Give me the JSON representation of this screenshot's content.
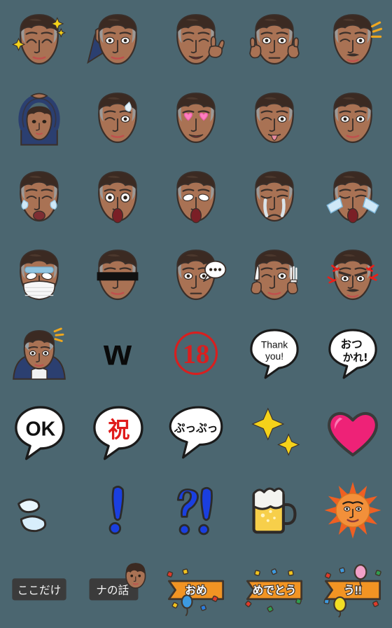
{
  "page": {
    "title": "Emoji sticker set preview",
    "background_color": "#4b6670",
    "columns": 5,
    "rows": 8,
    "cell_size_px": 112,
    "total_stickers": 40
  },
  "palette": {
    "background": "#4b6670",
    "skin": "#a97254",
    "skin_shadow": "#8d5b40",
    "hair": "#3b2a22",
    "hair_gray": "#9aa0a3",
    "outline": "#3a2f2a",
    "suit_navy": "#2b3f70",
    "shirt_white": "#f2f2f2",
    "sparkle_yellow": "#f5d21a",
    "heart_pink": "#ee2277",
    "stamp_red": "#d81f1f",
    "bubble_white": "#ffffff",
    "bubble_outline": "#1a1a1a",
    "banner_orange": "#f29423",
    "banner_outline": "#3f352c",
    "label_dark": "#3b3b3b",
    "beer_amber": "#f7cf4a",
    "beer_foam": "#f4f4f0",
    "sun_orange": "#f2903a",
    "exclaim_blue": "#1a3fe0",
    "tear_blue": "#cfe8f7",
    "angry_red": "#e8201a",
    "red_text": "#e01b1b",
    "blush": "#c0504d"
  },
  "stickers": [
    {
      "row": 1,
      "col": 1,
      "name": "face-sparkle",
      "label": "Face with sparkles",
      "text": ""
    },
    {
      "row": 1,
      "col": 2,
      "name": "face-listening",
      "label": "Hand to ear listening",
      "text": ""
    },
    {
      "row": 1,
      "col": 3,
      "name": "face-peace-sign",
      "label": "Face with peace sign",
      "text": ""
    },
    {
      "row": 1,
      "col": 4,
      "name": "face-thumbs-up-double",
      "label": "Face with two thumbs up",
      "text": ""
    },
    {
      "row": 1,
      "col": 5,
      "name": "face-idea-spark",
      "label": "Face with idea spark",
      "text": ""
    },
    {
      "row": 2,
      "col": 1,
      "name": "face-arms-circle-ok",
      "label": "Arms overhead circle OK",
      "text": ""
    },
    {
      "row": 2,
      "col": 2,
      "name": "face-wink-sweat",
      "label": "Winking face with sweat drop",
      "text": ""
    },
    {
      "row": 2,
      "col": 3,
      "name": "face-heart-eyes",
      "label": "Face with heart eyes",
      "text": ""
    },
    {
      "row": 2,
      "col": 4,
      "name": "face-tongue-out",
      "label": "Face with tongue out",
      "text": ""
    },
    {
      "row": 2,
      "col": 5,
      "name": "face-smirk",
      "label": "Smirking face",
      "text": ""
    },
    {
      "row": 3,
      "col": 1,
      "name": "face-laugh-tears",
      "label": "Laughing with tears of joy",
      "text": ""
    },
    {
      "row": 3,
      "col": 2,
      "name": "face-shocked-wide-eyes",
      "label": "Shocked face wide eyes",
      "text": ""
    },
    {
      "row": 3,
      "col": 3,
      "name": "face-screaming",
      "label": "Screaming face",
      "text": ""
    },
    {
      "row": 3,
      "col": 4,
      "name": "face-crying-streams",
      "label": "Crying face streaming tears",
      "text": ""
    },
    {
      "row": 3,
      "col": 5,
      "name": "face-sobbing-loud",
      "label": "Loudly sobbing face",
      "text": ""
    },
    {
      "row": 4,
      "col": 1,
      "name": "face-sick-mask",
      "label": "Sick face with surgical mask",
      "text": ""
    },
    {
      "row": 4,
      "col": 2,
      "name": "face-censor-bar",
      "label": "Face with censor bar over eyes",
      "text": ""
    },
    {
      "row": 4,
      "col": 3,
      "name": "face-thought-dots",
      "label": "Face with thought bubble dots",
      "text": ""
    },
    {
      "row": 4,
      "col": 4,
      "name": "face-knife-fork",
      "label": "Face holding knife and fork",
      "text": ""
    },
    {
      "row": 4,
      "col": 5,
      "name": "face-angry-veins",
      "label": "Angry face with anger marks",
      "text": ""
    },
    {
      "row": 5,
      "col": 1,
      "name": "figure-bowing-apology",
      "label": "Bowing apology with sweat",
      "text": ""
    },
    {
      "row": 5,
      "col": 2,
      "name": "letter-w-laugh",
      "label": "Black letter w (laughter)",
      "text": "w"
    },
    {
      "row": 5,
      "col": 3,
      "name": "stamp-eighteen",
      "label": "Red 18 rating stamp",
      "text": "18"
    },
    {
      "row": 5,
      "col": 4,
      "name": "bubble-thank-you",
      "label": "Speech bubble thank you",
      "text": "Thank you!"
    },
    {
      "row": 5,
      "col": 5,
      "name": "bubble-otsukare",
      "label": "Speech bubble otsukare",
      "text": "おつかれ!"
    },
    {
      "row": 6,
      "col": 1,
      "name": "bubble-ok",
      "label": "Speech bubble OK",
      "text": "OK"
    },
    {
      "row": 6,
      "col": 2,
      "name": "bubble-shuku",
      "label": "Speech bubble celebration kanji",
      "text": "祝"
    },
    {
      "row": 6,
      "col": 3,
      "name": "bubble-puppu",
      "label": "Speech bubble puppu",
      "text": "ぷっぷっ"
    },
    {
      "row": 6,
      "col": 4,
      "name": "sparkles-pair",
      "label": "Pair of yellow sparkles",
      "text": ""
    },
    {
      "row": 6,
      "col": 5,
      "name": "heart-pink",
      "label": "Pink heart",
      "text": ""
    },
    {
      "row": 7,
      "col": 1,
      "name": "sweat-drops",
      "label": "Two sweat drops",
      "text": ""
    },
    {
      "row": 7,
      "col": 2,
      "name": "exclamation-mark",
      "label": "Blue exclamation mark",
      "text": "!"
    },
    {
      "row": 7,
      "col": 3,
      "name": "interrobang-marks",
      "label": "Blue question and exclamation",
      "text": "?!"
    },
    {
      "row": 7,
      "col": 4,
      "name": "beer-mug",
      "label": "Beer mug with foam",
      "text": ""
    },
    {
      "row": 7,
      "col": 5,
      "name": "sun-face",
      "label": "Sun with face",
      "text": ""
    },
    {
      "row": 8,
      "col": 1,
      "name": "label-koko-dake",
      "label": "Dark label here only",
      "text": "ここだけ"
    },
    {
      "row": 8,
      "col": 2,
      "name": "label-na-no-hanashi",
      "label": "Dark label na no hanashi w/ face",
      "text": "ナの話"
    },
    {
      "row": 8,
      "col": 3,
      "name": "banner-omedetou-part1",
      "label": "Orange banner omedetou part 1",
      "text": "おめ"
    },
    {
      "row": 8,
      "col": 4,
      "name": "banner-omedetou-part2",
      "label": "Orange banner omedetou part 2",
      "text": "めでとう"
    },
    {
      "row": 8,
      "col": 5,
      "name": "banner-omedetou-part3",
      "label": "Orange banner omedetou part 3",
      "text": "う!!"
    }
  ]
}
